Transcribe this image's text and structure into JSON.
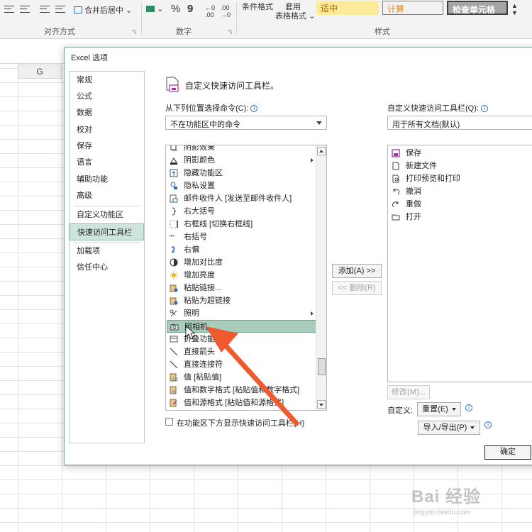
{
  "ribbon": {
    "merge_center": "合并后居中",
    "cond_format": "条件格式",
    "table_format_1": "套用",
    "table_format_2": "表格格式",
    "percent": "%",
    "comma": "9",
    "styles": {
      "neutral": "适中",
      "calc": "计算",
      "check_cell": "检查单元格"
    },
    "groups": {
      "alignment": "对齐方式",
      "number": "数字",
      "styles": "样式"
    }
  },
  "sheet": {
    "column": "G"
  },
  "dialog": {
    "title": "Excel 选项",
    "nav": [
      "常规",
      "公式",
      "数据",
      "校对",
      "保存",
      "语言",
      "辅助功能",
      "高级",
      "自定义功能区",
      "快速访问工具栏",
      "加载项",
      "信任中心"
    ],
    "header_title": "自定义快速访问工具栏。",
    "choose_from_label": "从下列位置选择命令(C):",
    "choose_from_value": "不在功能区中的命令",
    "customize_label": "自定义快速访问工具栏(Q):",
    "customize_value": "用于所有文档(默认)",
    "commands": [
      {
        "label": "阴影效果",
        "icon": "shadow-effect-icon"
      },
      {
        "label": "阴影颜色",
        "icon": "shadow-color-icon",
        "sub": true
      },
      {
        "label": "隐藏功能区",
        "icon": "hide-ribbon-icon"
      },
      {
        "label": "隐私设置",
        "icon": "privacy-icon"
      },
      {
        "label": "邮件收件人 [发送至邮件收件人]",
        "icon": "mail-recipient-icon"
      },
      {
        "label": "右大括号",
        "icon": "right-brace-icon"
      },
      {
        "label": "右框线 [切换右框线]",
        "icon": "right-border-icon"
      },
      {
        "label": "右括号",
        "icon": "right-paren-icon"
      },
      {
        "label": "右偏",
        "icon": "right-skew-icon"
      },
      {
        "label": "增加对比度",
        "icon": "contrast-icon"
      },
      {
        "label": "增加亮度",
        "icon": "brightness-icon"
      },
      {
        "label": "粘贴链接...",
        "icon": "paste-link-icon"
      },
      {
        "label": "粘贴为超链接",
        "icon": "paste-hyperlink-icon"
      },
      {
        "label": "照明",
        "icon": "lighting-icon",
        "sub": true
      },
      {
        "label": "照相机",
        "icon": "camera-icon",
        "selected": true
      },
      {
        "label": "折叠功能区",
        "icon": "collapse-ribbon-icon"
      },
      {
        "label": "直接箭头",
        "icon": "straight-arrow-icon"
      },
      {
        "label": "直接连接符",
        "icon": "straight-connector-icon"
      },
      {
        "label": "值 [粘贴值]",
        "icon": "paste-values-icon"
      },
      {
        "label": "值和数字格式 [粘贴值和数字格式]",
        "icon": "paste-values-number-icon"
      },
      {
        "label": "值和源格式 [粘贴值和源格式]",
        "icon": "paste-values-source-icon"
      }
    ],
    "qat_items": [
      {
        "label": "保存",
        "icon": "save-icon"
      },
      {
        "label": "新建文件",
        "icon": "new-file-icon"
      },
      {
        "label": "打印预览和打印",
        "icon": "print-preview-icon"
      },
      {
        "label": "撤消",
        "icon": "undo-icon"
      },
      {
        "label": "重做",
        "icon": "redo-icon"
      },
      {
        "label": "打开",
        "icon": "open-icon"
      }
    ],
    "add_button": "添加(A) >>",
    "remove_button": "<< 删除(R)",
    "modify_button": "修改(M)...",
    "customize_text": "自定义:",
    "reset_button": "重置(E)",
    "import_export_button": "导入/导出(P)",
    "show_below_label": "在功能区下方显示快速访问工具栏(H)",
    "ok_button": "确定"
  },
  "watermark": {
    "main": "Bai 经验",
    "sub": "jingyan.baidu.com"
  },
  "colors": {
    "accent": "#217346",
    "selection": "#a9cdbd",
    "arrow": "#ef5a2f"
  }
}
